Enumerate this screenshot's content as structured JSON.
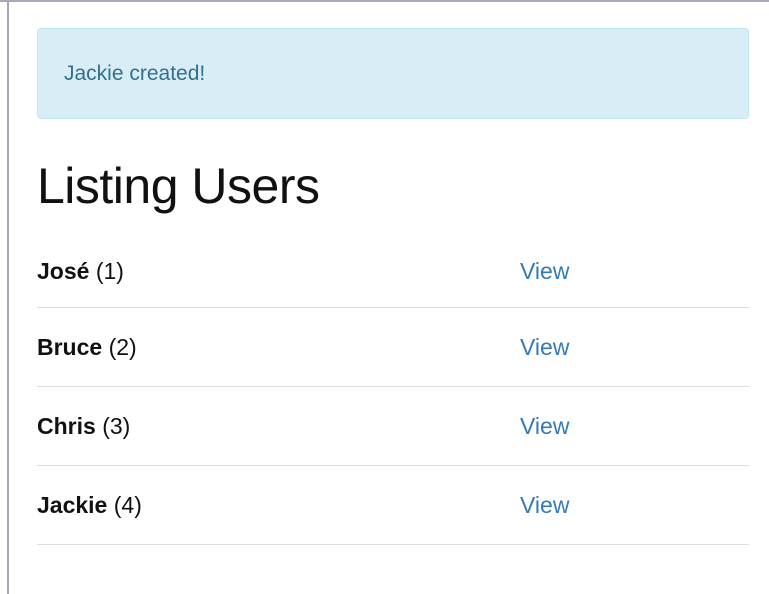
{
  "flash": {
    "message": "Jackie created!"
  },
  "page": {
    "title": "Listing Users"
  },
  "users": [
    {
      "name": "José",
      "id_text": "(1)",
      "action_label": "View"
    },
    {
      "name": "Bruce",
      "id_text": "(2)",
      "action_label": "View"
    },
    {
      "name": "Chris",
      "id_text": "(3)",
      "action_label": "View"
    },
    {
      "name": "Jackie",
      "id_text": "(4)",
      "action_label": "View"
    }
  ],
  "colors": {
    "alert_background": "#d9edf7",
    "alert_border": "#bce8f1",
    "alert_text": "#31708f",
    "link": "#337ab7",
    "divider": "#dddddd"
  }
}
